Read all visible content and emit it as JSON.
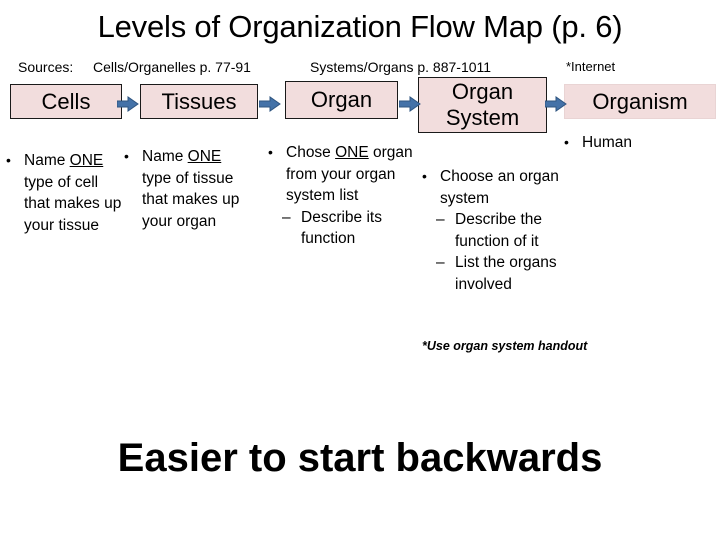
{
  "slide": {
    "title": "Levels of Organization Flow Map (p. 6)",
    "bottom_heading": "Easier to start backwards",
    "background_color": "#FFFFFF"
  },
  "sources": {
    "label": "Sources:",
    "cells_source": "Cells/Organelles p. 77-91",
    "systems_source": "Systems/Organs p. 887-1011",
    "internet_source": "*Internet"
  },
  "flow": {
    "box_fill_color": "#F2DDDD",
    "box_border_color": "#1A1A1A",
    "arrow_color": "#4472A8",
    "boxes": [
      {
        "label": "Cells"
      },
      {
        "label": "Tissues"
      },
      {
        "label": "Organ"
      },
      {
        "label": "Organ System"
      },
      {
        "label": "Organism"
      }
    ],
    "arrows": [
      {
        "name": "arrow-cells-to-tissues"
      },
      {
        "name": "arrow-tissues-to-organ"
      },
      {
        "name": "arrow-organ-to-organ-system"
      },
      {
        "name": "arrow-organ-system-to-organism"
      }
    ]
  },
  "columns": {
    "cells": {
      "bullet_marker": "•",
      "line1": "Name ",
      "emphasis": "ONE",
      "line2": " type of cell that makes up your tissue"
    },
    "tissues": {
      "bullet_marker": "•",
      "line1": "Name ",
      "emphasis": "ONE",
      "line2": " type of  tissue that makes up your organ"
    },
    "organ": {
      "bullet_marker": "•",
      "line1": "Chose ",
      "emphasis": "ONE",
      "line2": " organ from your organ system list",
      "sub_marker": "–",
      "sub_item": "Describe its function"
    },
    "organ_system": {
      "bullet_marker": "•",
      "line1": "Choose an organ system",
      "sub_marker_1": "–",
      "sub_item_1": "Describe the function of it",
      "sub_marker_2": "–",
      "sub_item_2": "List the organs involved"
    },
    "organism": {
      "bullet_marker": "•",
      "line1": "Human"
    }
  },
  "footnote": {
    "text": "*Use organ system handout"
  }
}
